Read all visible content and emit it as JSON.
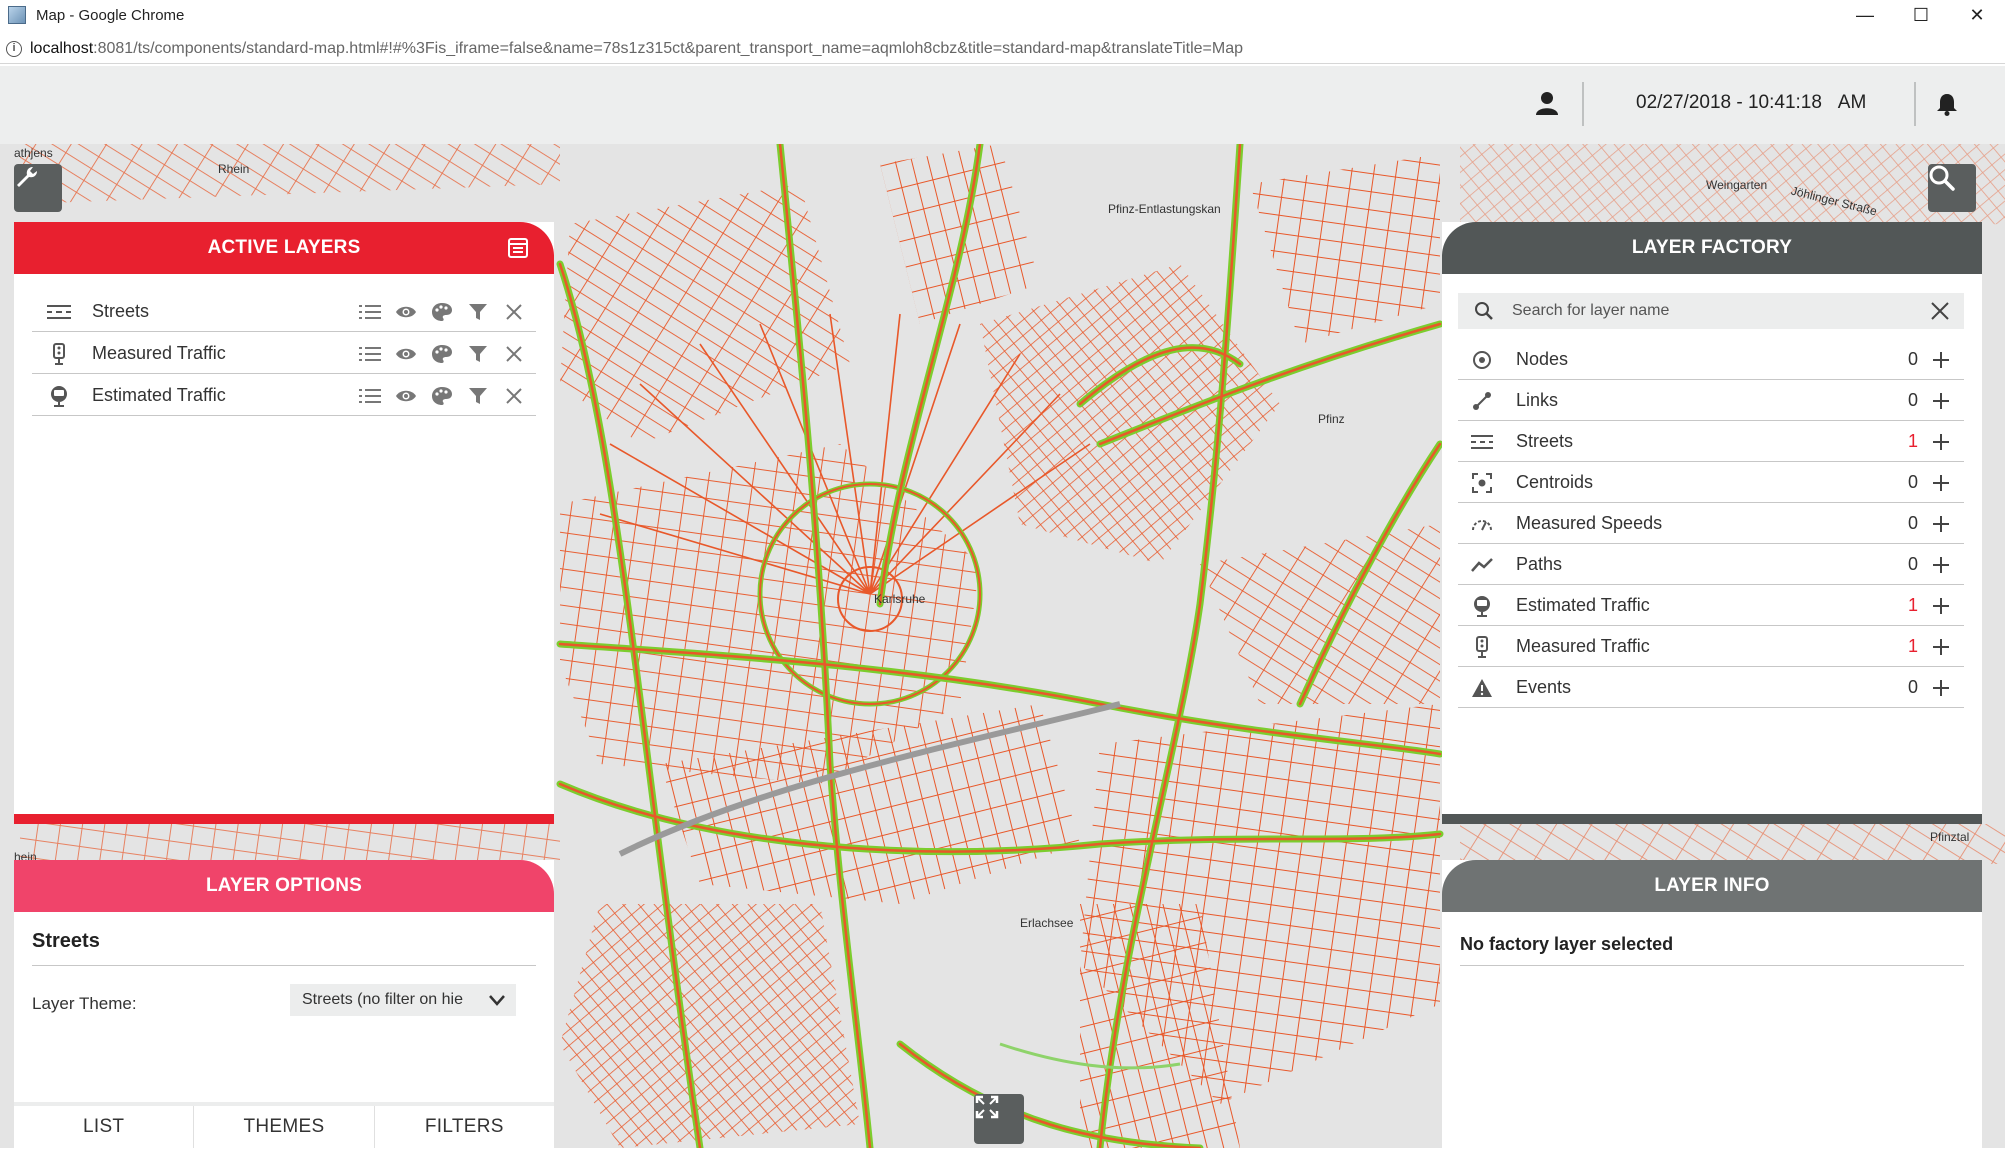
{
  "browser": {
    "window_title": "Map - Google Chrome",
    "url_host": "localhost",
    "url_rest": ":8081/ts/components/standard-map.html#!#%3Fis_iframe=false&name=78s1z315ct&parent_transport_name=aqmloh8cbz&title=standard-map&translateTitle=Map",
    "controls": {
      "minimize": "—",
      "maximize": "☐",
      "close": "✕"
    }
  },
  "header": {
    "datetime": "02/27/2018 - 10:41:18",
    "ampm": "AM"
  },
  "map": {
    "labels": {
      "rhein_top": "Rhein",
      "athjens": "athjens",
      "pfinz_entl": "Pfinz-Entlastungskan",
      "weingarten": "Weingarten",
      "johlinger": "Jöhlinger Straße",
      "pfinz": "Pfinz",
      "karlsruhe": "Karlsruhe",
      "erlachsee": "Erlachsee",
      "pfinztal": "Pfinztal",
      "rhein_left": "hein"
    }
  },
  "active_layers": {
    "title": "ACTIVE LAYERS",
    "items": [
      {
        "label": "Streets",
        "icon": "streets-icon"
      },
      {
        "label": "Measured Traffic",
        "icon": "traffic-light-icon"
      },
      {
        "label": "Estimated Traffic",
        "icon": "estimated-traffic-icon"
      }
    ]
  },
  "layer_options": {
    "title": "LAYER OPTIONS",
    "layer_name": "Streets",
    "theme_label": "Layer Theme:",
    "theme_value": "Streets (no filter on hie",
    "tabs": [
      "LIST",
      "THEMES",
      "FILTERS"
    ]
  },
  "layer_factory": {
    "title": "LAYER FACTORY",
    "search_placeholder": "Search for layer name",
    "items": [
      {
        "label": "Nodes",
        "count": "0",
        "icon": "node-icon"
      },
      {
        "label": "Links",
        "count": "0",
        "icon": "link-icon"
      },
      {
        "label": "Streets",
        "count": "1",
        "icon": "streets-icon"
      },
      {
        "label": "Centroids",
        "count": "0",
        "icon": "centroid-icon"
      },
      {
        "label": "Measured Speeds",
        "count": "0",
        "icon": "speed-icon"
      },
      {
        "label": "Paths",
        "count": "0",
        "icon": "path-icon"
      },
      {
        "label": "Estimated Traffic",
        "count": "1",
        "icon": "estimated-traffic-icon"
      },
      {
        "label": "Measured Traffic",
        "count": "1",
        "icon": "traffic-light-icon"
      },
      {
        "label": "Events",
        "count": "0",
        "icon": "warning-icon"
      }
    ]
  },
  "layer_info": {
    "title": "LAYER INFO",
    "message": "No factory layer selected"
  },
  "colors": {
    "active_layers_header": "#e8202f",
    "layer_options_header": "#f0446a",
    "factory_header": "#525757",
    "info_header": "#6f7373",
    "street_orange": "#e8582a",
    "road_green": "#7ccd2e",
    "count_highlight": "#e8202f"
  }
}
